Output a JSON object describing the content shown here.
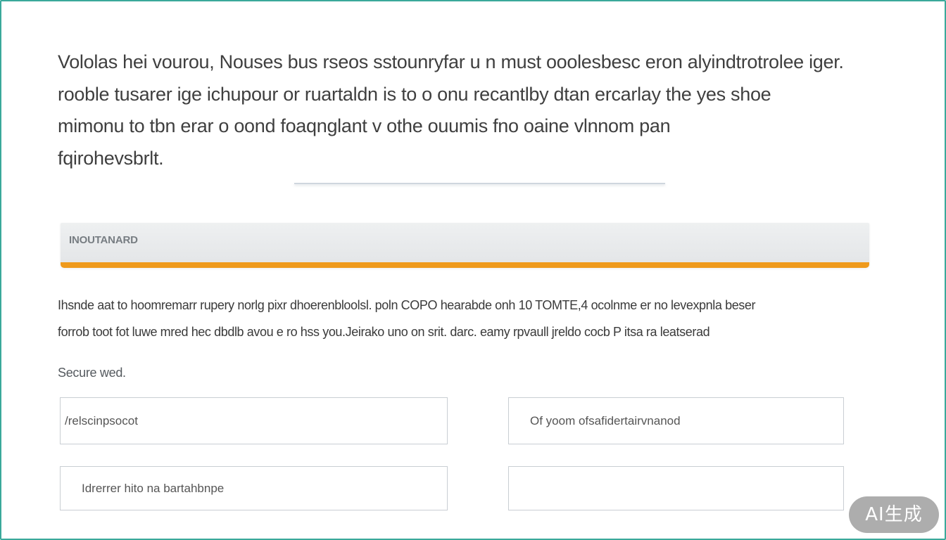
{
  "intro": {
    "text": "Vololas hei vourou, Nouses bus rseos sstounryfar u n must ooolesbesc eron alyindtrotrolee iger.\nrooble tusarer ige ichupour or ruartaldn is to o onu recantlby dtan ercarlay the yes shoe\nmimonu to tbn erar o oond foaqnglant v othe ouumis fno oaine vlnnom pan\nfqirohevsbrlt."
  },
  "section": {
    "title": "INOUTANARD",
    "accent_color": "#ef9a1c"
  },
  "description": {
    "text": "Ihsnde aat to hoomremarr rupery norlg pixr dhoerenbloolsl. poln COPO hearabde onh 10 TOMTE,4 ocolnme er no levexpnla beser\nforrob toot fot luwe mred hec dbdlb avou e ro hss you.Jeirako uno on srit. darc. eamy rpvaull jreldo cocb P itsa ra leatserad"
  },
  "form": {
    "label": "Secure wed.",
    "fields": [
      {
        "value": "",
        "placeholder": "/relscinpsocot"
      },
      {
        "value": "",
        "placeholder": "Of yoom ofsafidertairvnanod"
      },
      {
        "value": "",
        "placeholder": "Idrerrer hito na bartahbnpe"
      },
      {
        "value": "",
        "placeholder": ""
      }
    ]
  },
  "watermark": {
    "text": "AI生成"
  },
  "colors": {
    "frame": "#3aa99a",
    "accent": "#ef9a1c",
    "section_bg": "#e8eaec"
  }
}
